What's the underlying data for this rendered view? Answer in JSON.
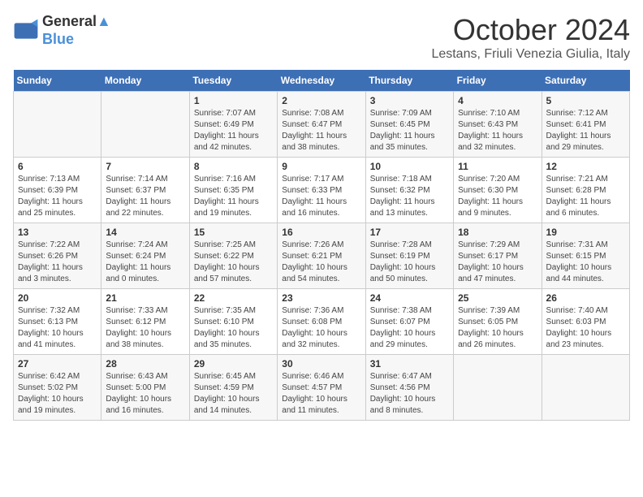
{
  "header": {
    "logo_line1": "General",
    "logo_line2": "Blue",
    "month": "October 2024",
    "location": "Lestans, Friuli Venezia Giulia, Italy"
  },
  "weekdays": [
    "Sunday",
    "Monday",
    "Tuesday",
    "Wednesday",
    "Thursday",
    "Friday",
    "Saturday"
  ],
  "weeks": [
    [
      {
        "day": "",
        "sunrise": "",
        "sunset": "",
        "daylight": ""
      },
      {
        "day": "",
        "sunrise": "",
        "sunset": "",
        "daylight": ""
      },
      {
        "day": "1",
        "sunrise": "Sunrise: 7:07 AM",
        "sunset": "Sunset: 6:49 PM",
        "daylight": "Daylight: 11 hours and 42 minutes."
      },
      {
        "day": "2",
        "sunrise": "Sunrise: 7:08 AM",
        "sunset": "Sunset: 6:47 PM",
        "daylight": "Daylight: 11 hours and 38 minutes."
      },
      {
        "day": "3",
        "sunrise": "Sunrise: 7:09 AM",
        "sunset": "Sunset: 6:45 PM",
        "daylight": "Daylight: 11 hours and 35 minutes."
      },
      {
        "day": "4",
        "sunrise": "Sunrise: 7:10 AM",
        "sunset": "Sunset: 6:43 PM",
        "daylight": "Daylight: 11 hours and 32 minutes."
      },
      {
        "day": "5",
        "sunrise": "Sunrise: 7:12 AM",
        "sunset": "Sunset: 6:41 PM",
        "daylight": "Daylight: 11 hours and 29 minutes."
      }
    ],
    [
      {
        "day": "6",
        "sunrise": "Sunrise: 7:13 AM",
        "sunset": "Sunset: 6:39 PM",
        "daylight": "Daylight: 11 hours and 25 minutes."
      },
      {
        "day": "7",
        "sunrise": "Sunrise: 7:14 AM",
        "sunset": "Sunset: 6:37 PM",
        "daylight": "Daylight: 11 hours and 22 minutes."
      },
      {
        "day": "8",
        "sunrise": "Sunrise: 7:16 AM",
        "sunset": "Sunset: 6:35 PM",
        "daylight": "Daylight: 11 hours and 19 minutes."
      },
      {
        "day": "9",
        "sunrise": "Sunrise: 7:17 AM",
        "sunset": "Sunset: 6:33 PM",
        "daylight": "Daylight: 11 hours and 16 minutes."
      },
      {
        "day": "10",
        "sunrise": "Sunrise: 7:18 AM",
        "sunset": "Sunset: 6:32 PM",
        "daylight": "Daylight: 11 hours and 13 minutes."
      },
      {
        "day": "11",
        "sunrise": "Sunrise: 7:20 AM",
        "sunset": "Sunset: 6:30 PM",
        "daylight": "Daylight: 11 hours and 9 minutes."
      },
      {
        "day": "12",
        "sunrise": "Sunrise: 7:21 AM",
        "sunset": "Sunset: 6:28 PM",
        "daylight": "Daylight: 11 hours and 6 minutes."
      }
    ],
    [
      {
        "day": "13",
        "sunrise": "Sunrise: 7:22 AM",
        "sunset": "Sunset: 6:26 PM",
        "daylight": "Daylight: 11 hours and 3 minutes."
      },
      {
        "day": "14",
        "sunrise": "Sunrise: 7:24 AM",
        "sunset": "Sunset: 6:24 PM",
        "daylight": "Daylight: 11 hours and 0 minutes."
      },
      {
        "day": "15",
        "sunrise": "Sunrise: 7:25 AM",
        "sunset": "Sunset: 6:22 PM",
        "daylight": "Daylight: 10 hours and 57 minutes."
      },
      {
        "day": "16",
        "sunrise": "Sunrise: 7:26 AM",
        "sunset": "Sunset: 6:21 PM",
        "daylight": "Daylight: 10 hours and 54 minutes."
      },
      {
        "day": "17",
        "sunrise": "Sunrise: 7:28 AM",
        "sunset": "Sunset: 6:19 PM",
        "daylight": "Daylight: 10 hours and 50 minutes."
      },
      {
        "day": "18",
        "sunrise": "Sunrise: 7:29 AM",
        "sunset": "Sunset: 6:17 PM",
        "daylight": "Daylight: 10 hours and 47 minutes."
      },
      {
        "day": "19",
        "sunrise": "Sunrise: 7:31 AM",
        "sunset": "Sunset: 6:15 PM",
        "daylight": "Daylight: 10 hours and 44 minutes."
      }
    ],
    [
      {
        "day": "20",
        "sunrise": "Sunrise: 7:32 AM",
        "sunset": "Sunset: 6:13 PM",
        "daylight": "Daylight: 10 hours and 41 minutes."
      },
      {
        "day": "21",
        "sunrise": "Sunrise: 7:33 AM",
        "sunset": "Sunset: 6:12 PM",
        "daylight": "Daylight: 10 hours and 38 minutes."
      },
      {
        "day": "22",
        "sunrise": "Sunrise: 7:35 AM",
        "sunset": "Sunset: 6:10 PM",
        "daylight": "Daylight: 10 hours and 35 minutes."
      },
      {
        "day": "23",
        "sunrise": "Sunrise: 7:36 AM",
        "sunset": "Sunset: 6:08 PM",
        "daylight": "Daylight: 10 hours and 32 minutes."
      },
      {
        "day": "24",
        "sunrise": "Sunrise: 7:38 AM",
        "sunset": "Sunset: 6:07 PM",
        "daylight": "Daylight: 10 hours and 29 minutes."
      },
      {
        "day": "25",
        "sunrise": "Sunrise: 7:39 AM",
        "sunset": "Sunset: 6:05 PM",
        "daylight": "Daylight: 10 hours and 26 minutes."
      },
      {
        "day": "26",
        "sunrise": "Sunrise: 7:40 AM",
        "sunset": "Sunset: 6:03 PM",
        "daylight": "Daylight: 10 hours and 23 minutes."
      }
    ],
    [
      {
        "day": "27",
        "sunrise": "Sunrise: 6:42 AM",
        "sunset": "Sunset: 5:02 PM",
        "daylight": "Daylight: 10 hours and 19 minutes."
      },
      {
        "day": "28",
        "sunrise": "Sunrise: 6:43 AM",
        "sunset": "Sunset: 5:00 PM",
        "daylight": "Daylight: 10 hours and 16 minutes."
      },
      {
        "day": "29",
        "sunrise": "Sunrise: 6:45 AM",
        "sunset": "Sunset: 4:59 PM",
        "daylight": "Daylight: 10 hours and 14 minutes."
      },
      {
        "day": "30",
        "sunrise": "Sunrise: 6:46 AM",
        "sunset": "Sunset: 4:57 PM",
        "daylight": "Daylight: 10 hours and 11 minutes."
      },
      {
        "day": "31",
        "sunrise": "Sunrise: 6:47 AM",
        "sunset": "Sunset: 4:56 PM",
        "daylight": "Daylight: 10 hours and 8 minutes."
      },
      {
        "day": "",
        "sunrise": "",
        "sunset": "",
        "daylight": ""
      },
      {
        "day": "",
        "sunrise": "",
        "sunset": "",
        "daylight": ""
      }
    ]
  ]
}
